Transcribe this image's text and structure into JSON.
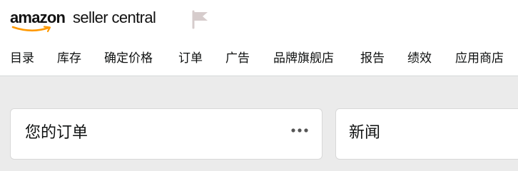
{
  "header": {
    "logo_amazon": "amazon",
    "logo_product": "seller central",
    "flag_icon": "flag-icon",
    "accent_color": "#ff9900"
  },
  "nav": {
    "items": [
      {
        "label": "目录"
      },
      {
        "label": "库存"
      },
      {
        "label": "确定价格"
      },
      {
        "label": "订单"
      },
      {
        "label": "广告"
      },
      {
        "label": "品牌旗舰店"
      },
      {
        "label": "报告"
      },
      {
        "label": "绩效"
      },
      {
        "label": "应用商店"
      }
    ]
  },
  "cards": {
    "orders": {
      "title": "您的订单",
      "menu_icon": "more-options-icon"
    },
    "news": {
      "title": "新闻"
    }
  }
}
